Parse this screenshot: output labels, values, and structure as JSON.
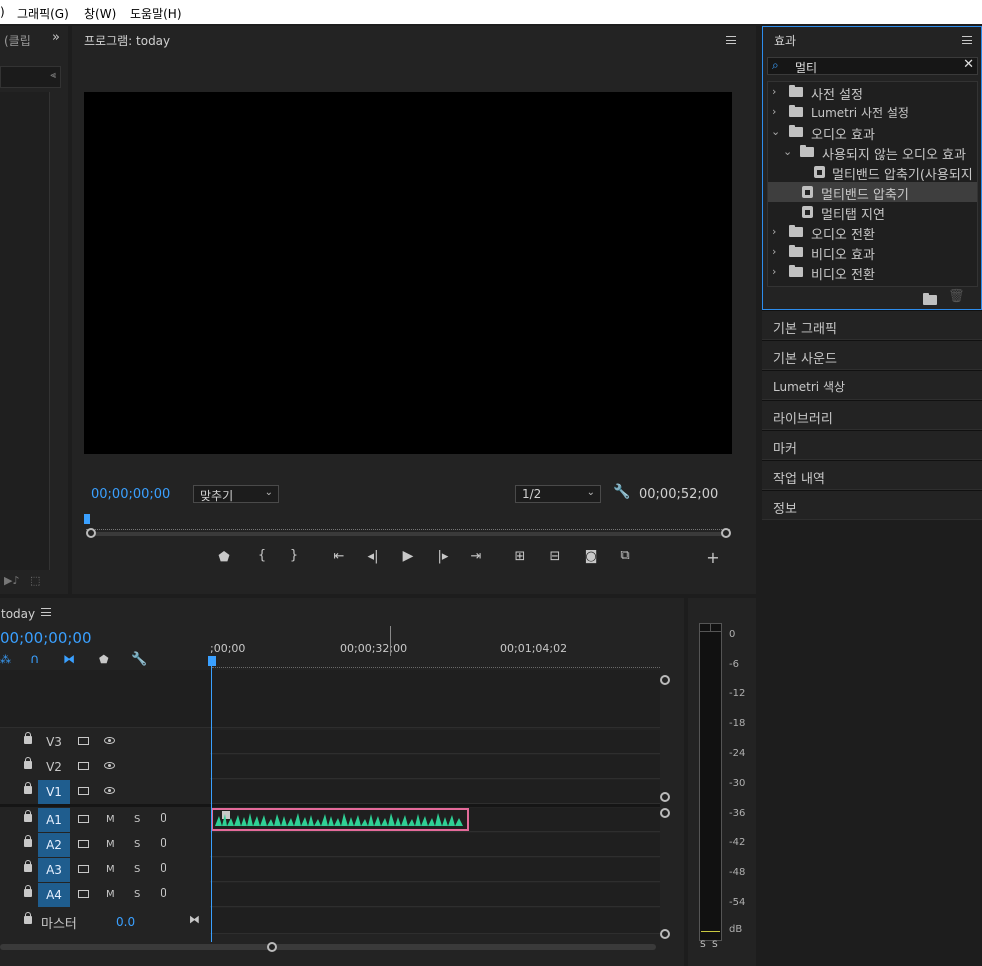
{
  "menubar": {
    "items": [
      ")",
      "그래픽(G)",
      "창(W)",
      "도움말(H)"
    ]
  },
  "left_panel": {
    "tab_text": "(클립",
    "overflow_icon": "double-chevron-right-icon"
  },
  "program_monitor": {
    "title": "프로그램: today",
    "timecode_current": "00;00;00;00",
    "fit_label": "맞추기",
    "resolution": "1/2",
    "timecode_duration": "00;00;52;00",
    "controls": {
      "marker": "marker-icon",
      "mark_in": "{",
      "mark_out": "}",
      "go_in": "go-to-in-icon",
      "step_back": "step-back-icon",
      "play": "play-icon",
      "step_fwd": "step-forward-icon",
      "go_out": "go-to-out-icon",
      "lift": "lift-icon",
      "extract": "extract-icon",
      "export_frame": "camera-icon",
      "compare": "compare-icon",
      "add": "+"
    }
  },
  "effects_panel": {
    "title": "효과",
    "search_value": "멀티",
    "tree": [
      {
        "label": "사전 설정",
        "type": "preset-folder",
        "expanded": false,
        "depth": 0
      },
      {
        "label": "Lumetri 사전 설정",
        "type": "preset-folder",
        "expanded": false,
        "depth": 0
      },
      {
        "label": "오디오 효과",
        "type": "folder",
        "expanded": true,
        "depth": 0
      },
      {
        "label": "사용되지 않는 오디오 효과",
        "type": "folder",
        "expanded": true,
        "depth": 1
      },
      {
        "label": "멀티밴드 압축기(사용되지",
        "type": "effect",
        "depth": 2
      },
      {
        "label": "멀티밴드 압축기",
        "type": "effect",
        "depth": 1,
        "selected": true
      },
      {
        "label": "멀티탭 지연",
        "type": "effect",
        "depth": 1
      },
      {
        "label": "오디오 전환",
        "type": "folder",
        "expanded": false,
        "depth": 0
      },
      {
        "label": "비디오 효과",
        "type": "folder",
        "expanded": false,
        "depth": 0
      },
      {
        "label": "비디오 전환",
        "type": "folder",
        "expanded": false,
        "depth": 0
      }
    ]
  },
  "side_sections": [
    "기본 그래픽",
    "기본 사운드",
    "Lumetri 색상",
    "라이브러리",
    "마커",
    "작업 내역",
    "정보"
  ],
  "timeline": {
    "title": "today",
    "timecode": "00;00;00;00",
    "ruler_labels": [
      ";00;00",
      "00;00;32;00",
      "00;01;04;02"
    ],
    "tracks": [
      {
        "name": "V3",
        "kind": "video",
        "targeted": false
      },
      {
        "name": "V2",
        "kind": "video",
        "targeted": false
      },
      {
        "name": "V1",
        "kind": "video",
        "targeted": true
      },
      {
        "name": "A1",
        "kind": "audio",
        "targeted": true
      },
      {
        "name": "A2",
        "kind": "audio",
        "targeted": true
      },
      {
        "name": "A3",
        "kind": "audio",
        "targeted": true
      },
      {
        "name": "A4",
        "kind": "audio",
        "targeted": true
      }
    ],
    "audio_btn_m": "M",
    "audio_btn_s": "S",
    "master_label": "마스터",
    "master_value": "0.0",
    "clip_color": "#2fd095",
    "clip_border": "#e46a9a"
  },
  "audio_meter": {
    "labels": [
      "0",
      "-6",
      "-12",
      "-18",
      "-24",
      "-30",
      "-36",
      "-42",
      "-48",
      "-54",
      "dB"
    ],
    "solo": [
      "S",
      "S"
    ]
  },
  "colors": {
    "accent": "#3aa0ff",
    "panel_bg": "#232323",
    "target_blue": "#1f5d8e"
  }
}
